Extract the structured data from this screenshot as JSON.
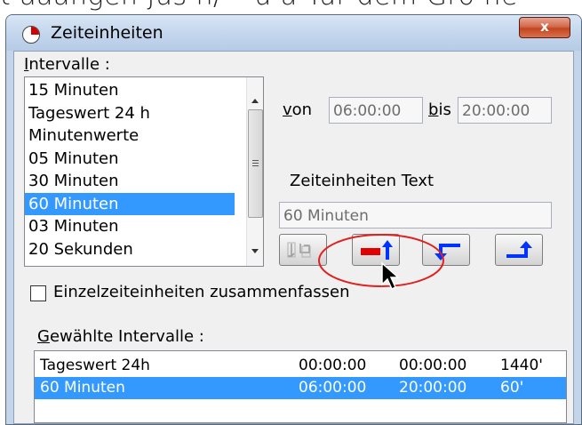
{
  "caption_fragment": "t aaängen Jus n/ ^u ä Tür dem Grö he",
  "window": {
    "title": "Zeiteinheiten",
    "close_label": "x"
  },
  "intervals": {
    "label_underlined": "I",
    "label_rest": "ntervalle :",
    "items": [
      "15 Minuten",
      "Tageswert 24 h",
      "Minutenwerte",
      "05 Minuten",
      "30 Minuten",
      "60 Minuten",
      "03 Minuten",
      "20 Sekunden"
    ],
    "selected_index": 5
  },
  "time_range": {
    "von_underlined": "v",
    "von_rest": "on",
    "von_value": "06:00:00",
    "bis_underlined": "b",
    "bis_rest": "is",
    "bis_value": "20:00:00"
  },
  "zeiteinheiten_text": {
    "label": "Zeiteinheiten Text",
    "value": "60 Minuten"
  },
  "buttons": [
    {
      "name": "split-icon",
      "enabled": false
    },
    {
      "name": "insert-up-icon",
      "enabled": true
    },
    {
      "name": "move-left-icon",
      "enabled": true
    },
    {
      "name": "move-right-up-icon",
      "enabled": true
    }
  ],
  "combine_checkbox": {
    "label": "Einzelzeiteinheiten zusammenfassen",
    "checked": false
  },
  "selected_intervals": {
    "label_underlined": "G",
    "label_rest": "ewählte Intervalle :",
    "rows": [
      {
        "name": "Tageswert 24h",
        "start": "00:00:00",
        "end": "00:00:00",
        "minutes": "1440'"
      },
      {
        "name": "60 Minuten",
        "start": "06:00:00",
        "end": "20:00:00",
        "minutes": "60'"
      }
    ],
    "selected_row": 1
  },
  "colors": {
    "selection": "#3399ff",
    "accent_red": "#e00000",
    "accent_blue": "#0033ff",
    "annotation_ellipse": "#e02020"
  }
}
